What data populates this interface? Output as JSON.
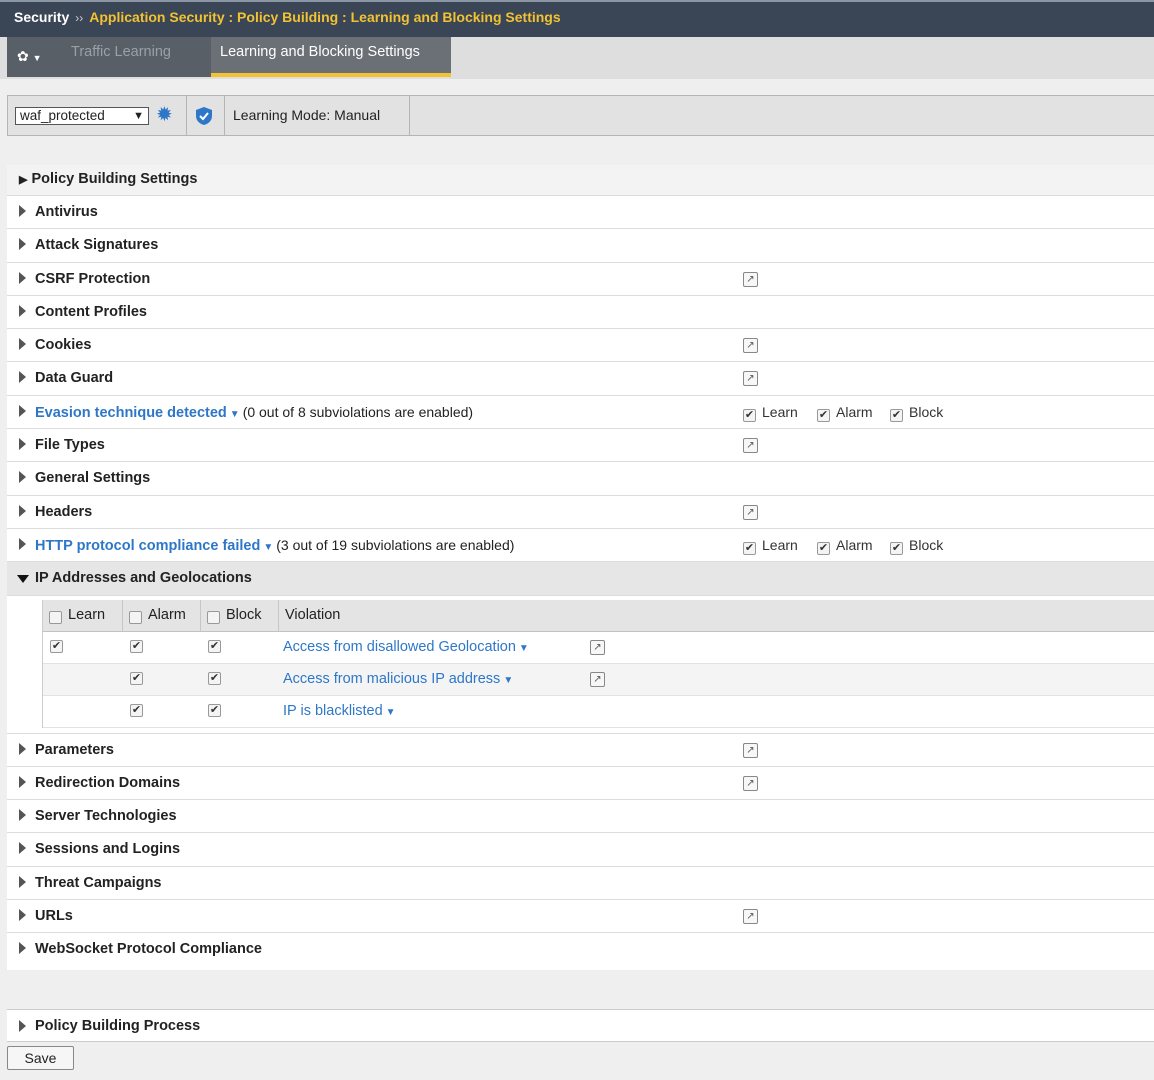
{
  "header": {
    "section": "Security",
    "separator": "››",
    "breadcrumb": "Application Security : Policy Building : Learning and Blocking Settings"
  },
  "tabs": [
    {
      "label": "Traffic Learning",
      "active": false
    },
    {
      "label": "Learning and Blocking Settings",
      "active": true
    }
  ],
  "toolbar": {
    "policy": "waf_protected",
    "learning_mode": "Learning Mode: Manual"
  },
  "settings_heading": "Policy Building Settings",
  "rows": [
    {
      "name": "Antivirus"
    },
    {
      "name": "Attack Signatures"
    },
    {
      "name": "CSRF Protection",
      "ext": true
    },
    {
      "name": "Content Profiles"
    },
    {
      "name": "Cookies",
      "ext": true
    },
    {
      "name": "Data Guard",
      "ext": true
    },
    {
      "name": "Evasion technique detected",
      "link": true,
      "sub": "(0 out of 8 subviolations are enabled)",
      "flags": {
        "learn": true,
        "alarm": true,
        "block": true
      }
    },
    {
      "name": "File Types",
      "ext": true
    },
    {
      "name": "General Settings"
    },
    {
      "name": "Headers",
      "ext": true
    },
    {
      "name": "HTTP protocol compliance failed",
      "link": true,
      "sub": "(3 out of 19 subviolations are enabled)",
      "flags": {
        "learn": true,
        "alarm": true,
        "block": true
      }
    },
    {
      "name": "IP Addresses and Geolocations",
      "open": true
    }
  ],
  "labels": {
    "learn": "Learn",
    "alarm": "Alarm",
    "block": "Block"
  },
  "ip_table": {
    "columns": [
      "Learn",
      "Alarm",
      "Block",
      "Violation"
    ],
    "rows": [
      {
        "learn": true,
        "alarm": true,
        "block": true,
        "violation": "Access from disallowed Geolocation",
        "ext": true
      },
      {
        "learn": false,
        "alarm": true,
        "block": true,
        "violation": "Access from malicious IP address",
        "ext": true
      },
      {
        "learn": false,
        "alarm": true,
        "block": true,
        "violation": "IP is blacklisted",
        "ext": false
      }
    ]
  },
  "rows_after": [
    {
      "name": "Parameters",
      "ext": true
    },
    {
      "name": "Redirection Domains",
      "ext": true
    },
    {
      "name": "Server Technologies"
    },
    {
      "name": "Sessions and Logins"
    },
    {
      "name": "Threat Campaigns"
    },
    {
      "name": "URLs",
      "ext": true
    },
    {
      "name": "WebSocket Protocol Compliance"
    }
  ],
  "process_heading": "Policy Building Process",
  "save_label": "Save",
  "colors": {
    "accent": "#f2c232",
    "link": "#2e77c8",
    "header_bg": "#3a4655"
  }
}
